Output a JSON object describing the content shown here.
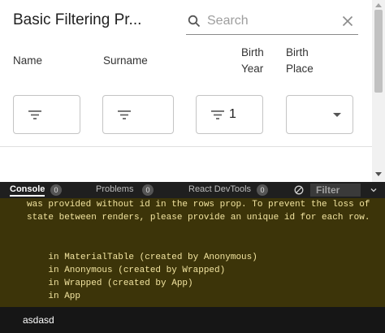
{
  "table": {
    "title": "Basic Filtering Pr...",
    "search": {
      "placeholder": "Search"
    },
    "columns": [
      {
        "line1": "Name",
        "line2": ""
      },
      {
        "line1": "Surname",
        "line2": ""
      },
      {
        "line1": "Birth",
        "line2": "Year"
      },
      {
        "line1": "Birth",
        "line2": "Place"
      }
    ],
    "filters": {
      "name": "",
      "surname": "",
      "birth_year": "1",
      "birth_place": ""
    }
  },
  "devtools": {
    "tabs": [
      {
        "label": "Console",
        "count": "0"
      },
      {
        "label": "Problems",
        "count": "0"
      },
      {
        "label": "React DevTools",
        "count": "0"
      }
    ],
    "filter_placeholder": "Filter",
    "console_lines": [
      "was provided without id in the rows prop. To prevent the loss of",
      "state between renders, please provide an unique id for each row.",
      "",
      "",
      "    in MaterialTable (created by Anonymous)",
      "    in Anonymous (created by Wrapped)",
      "    in Wrapped (created by App)",
      "    in App"
    ],
    "input_text": "asdasd"
  },
  "colors": {
    "console_bg": "#3c3409",
    "console_text": "#f2e4a0",
    "devtools_bar": "#1f1f1f"
  }
}
